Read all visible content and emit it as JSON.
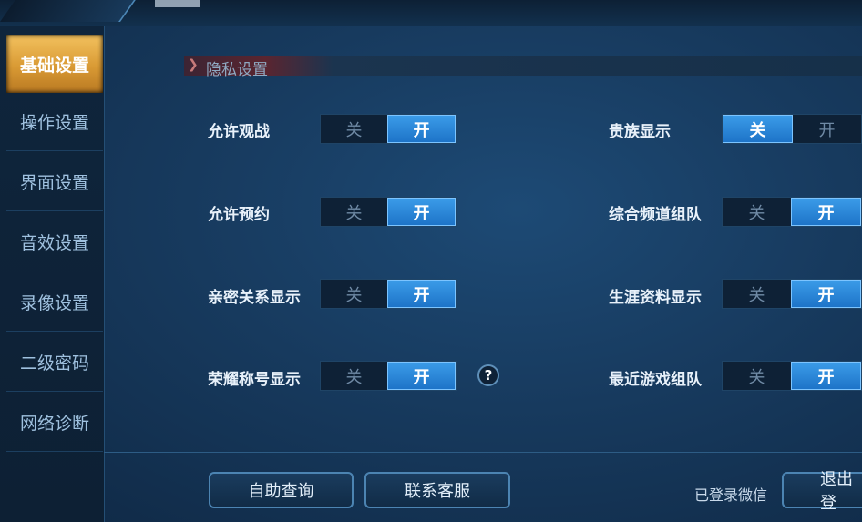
{
  "sidebar": {
    "items": [
      {
        "label": "基础设置",
        "active": true
      },
      {
        "label": "操作设置",
        "active": false
      },
      {
        "label": "界面设置",
        "active": false
      },
      {
        "label": "音效设置",
        "active": false
      },
      {
        "label": "录像设置",
        "active": false
      },
      {
        "label": "二级密码",
        "active": false
      },
      {
        "label": "网络诊断",
        "active": false
      }
    ]
  },
  "section": {
    "title": "隐私设置"
  },
  "settings": {
    "allow_watch": {
      "label": "允许观战",
      "off": "关",
      "on": "开",
      "value": "on"
    },
    "allow_reserve": {
      "label": "允许预约",
      "off": "关",
      "on": "开",
      "value": "on"
    },
    "intimate_display": {
      "label": "亲密关系显示",
      "off": "关",
      "on": "开",
      "value": "on"
    },
    "honor_title_display": {
      "label": "荣耀称号显示",
      "off": "关",
      "on": "开",
      "value": "on"
    },
    "noble_display": {
      "label": "贵族显示",
      "off": "关",
      "on": "开",
      "value": "off"
    },
    "channel_team": {
      "label": "综合频道组队",
      "off": "关",
      "on": "开",
      "value": "on"
    },
    "career_display": {
      "label": "生涯资料显示",
      "off": "关",
      "on": "开",
      "value": "on"
    },
    "recent_team": {
      "label": "最近游戏组队",
      "off": "关",
      "on": "开",
      "value": "on"
    }
  },
  "help": {
    "glyph": "?"
  },
  "footer": {
    "self_service": "自助查询",
    "contact_service": "联系客服",
    "login_status": "已登录微信",
    "logout": "退出登"
  },
  "colors": {
    "accent": "#2b8be0",
    "active_tab": "#e3a842",
    "background": "#173a5e"
  }
}
